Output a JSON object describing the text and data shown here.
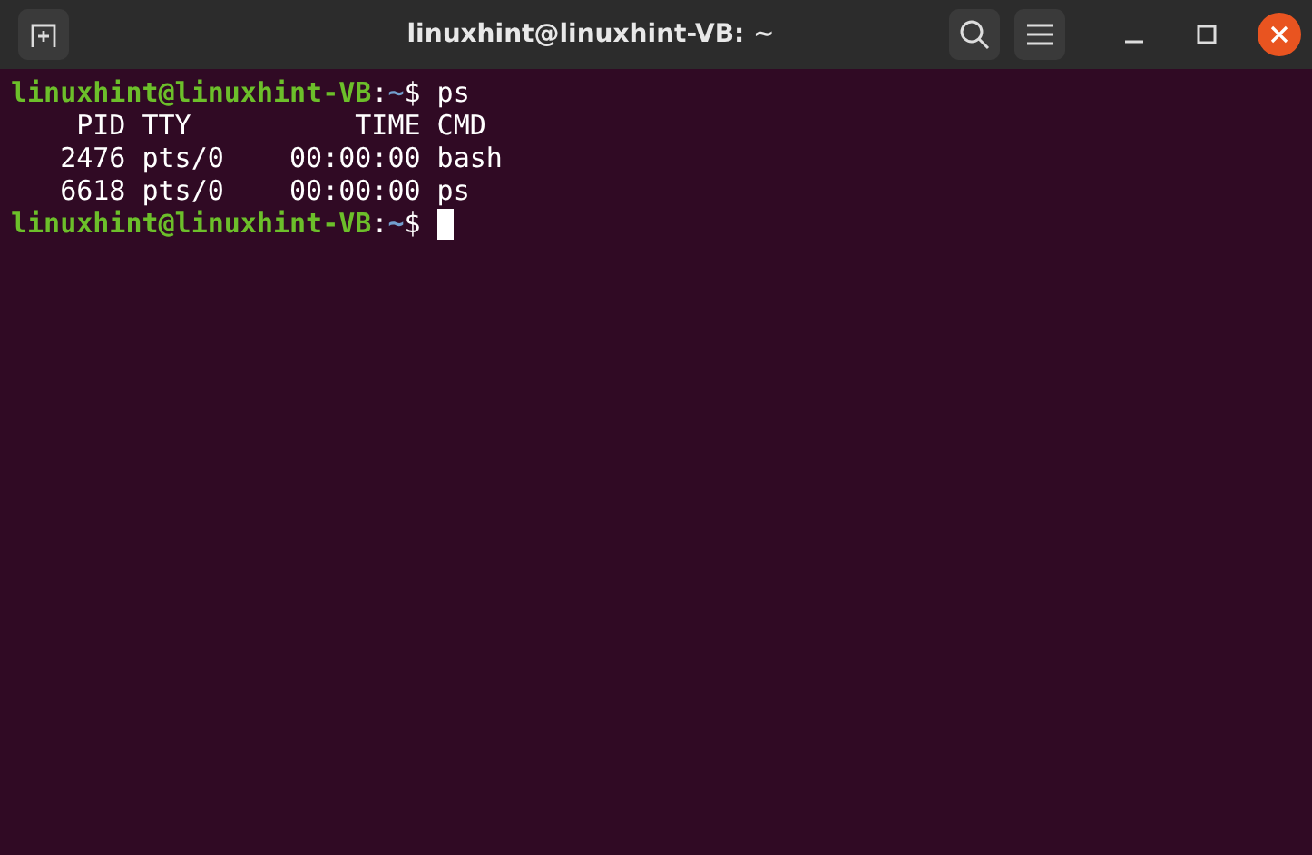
{
  "window": {
    "title": "linuxhint@linuxhint-VB: ~"
  },
  "terminal": {
    "lines": [
      {
        "kind": "prompt",
        "user": "linuxhint@linuxhint-VB",
        "sep": ":",
        "path": "~",
        "symbol": "$",
        "command": "ps",
        "cursor": false
      },
      {
        "kind": "output",
        "text": "    PID TTY          TIME CMD"
      },
      {
        "kind": "output",
        "text": "   2476 pts/0    00:00:00 bash"
      },
      {
        "kind": "output",
        "text": "   6618 pts/0    00:00:00 ps"
      },
      {
        "kind": "prompt",
        "user": "linuxhint@linuxhint-VB",
        "sep": ":",
        "path": "~",
        "symbol": "$",
        "cursor": true
      }
    ]
  }
}
